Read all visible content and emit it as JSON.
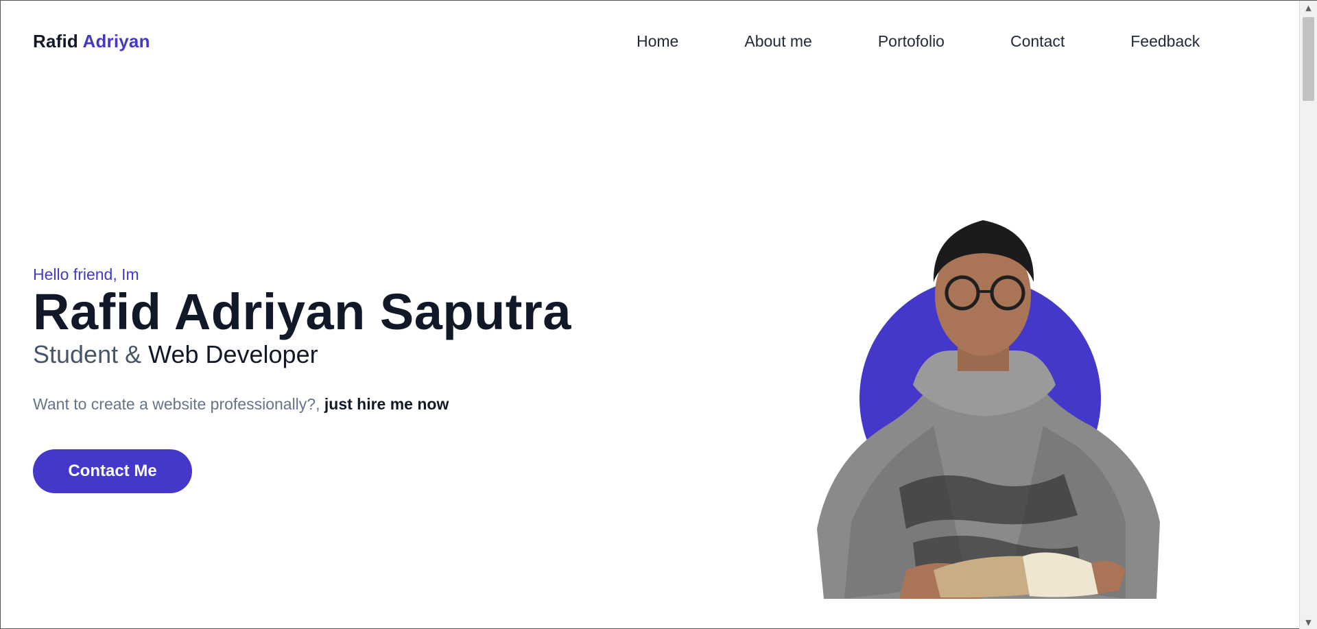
{
  "brand": {
    "first": "Rafid",
    "accent": "Adriyan"
  },
  "nav": {
    "home": "Home",
    "about": "About me",
    "portfolio": "Portofolio",
    "contact": "Contact",
    "feedback": "Feedback"
  },
  "hero": {
    "greeting": "Hello friend, Im",
    "name": "Rafid Adriyan Saputra",
    "role_part1": "Student & ",
    "role_part2": "Web Developer",
    "pitch_text": "Want to create a website professionally?, ",
    "pitch_strong": "just hire me now",
    "cta_label": "Contact Me"
  },
  "colors": {
    "accent": "#4338ca",
    "heading": "#111827",
    "muted": "#64748b"
  },
  "icons": {
    "scroll_up": "scroll-up-arrow-icon",
    "scroll_down": "scroll-down-arrow-icon"
  }
}
